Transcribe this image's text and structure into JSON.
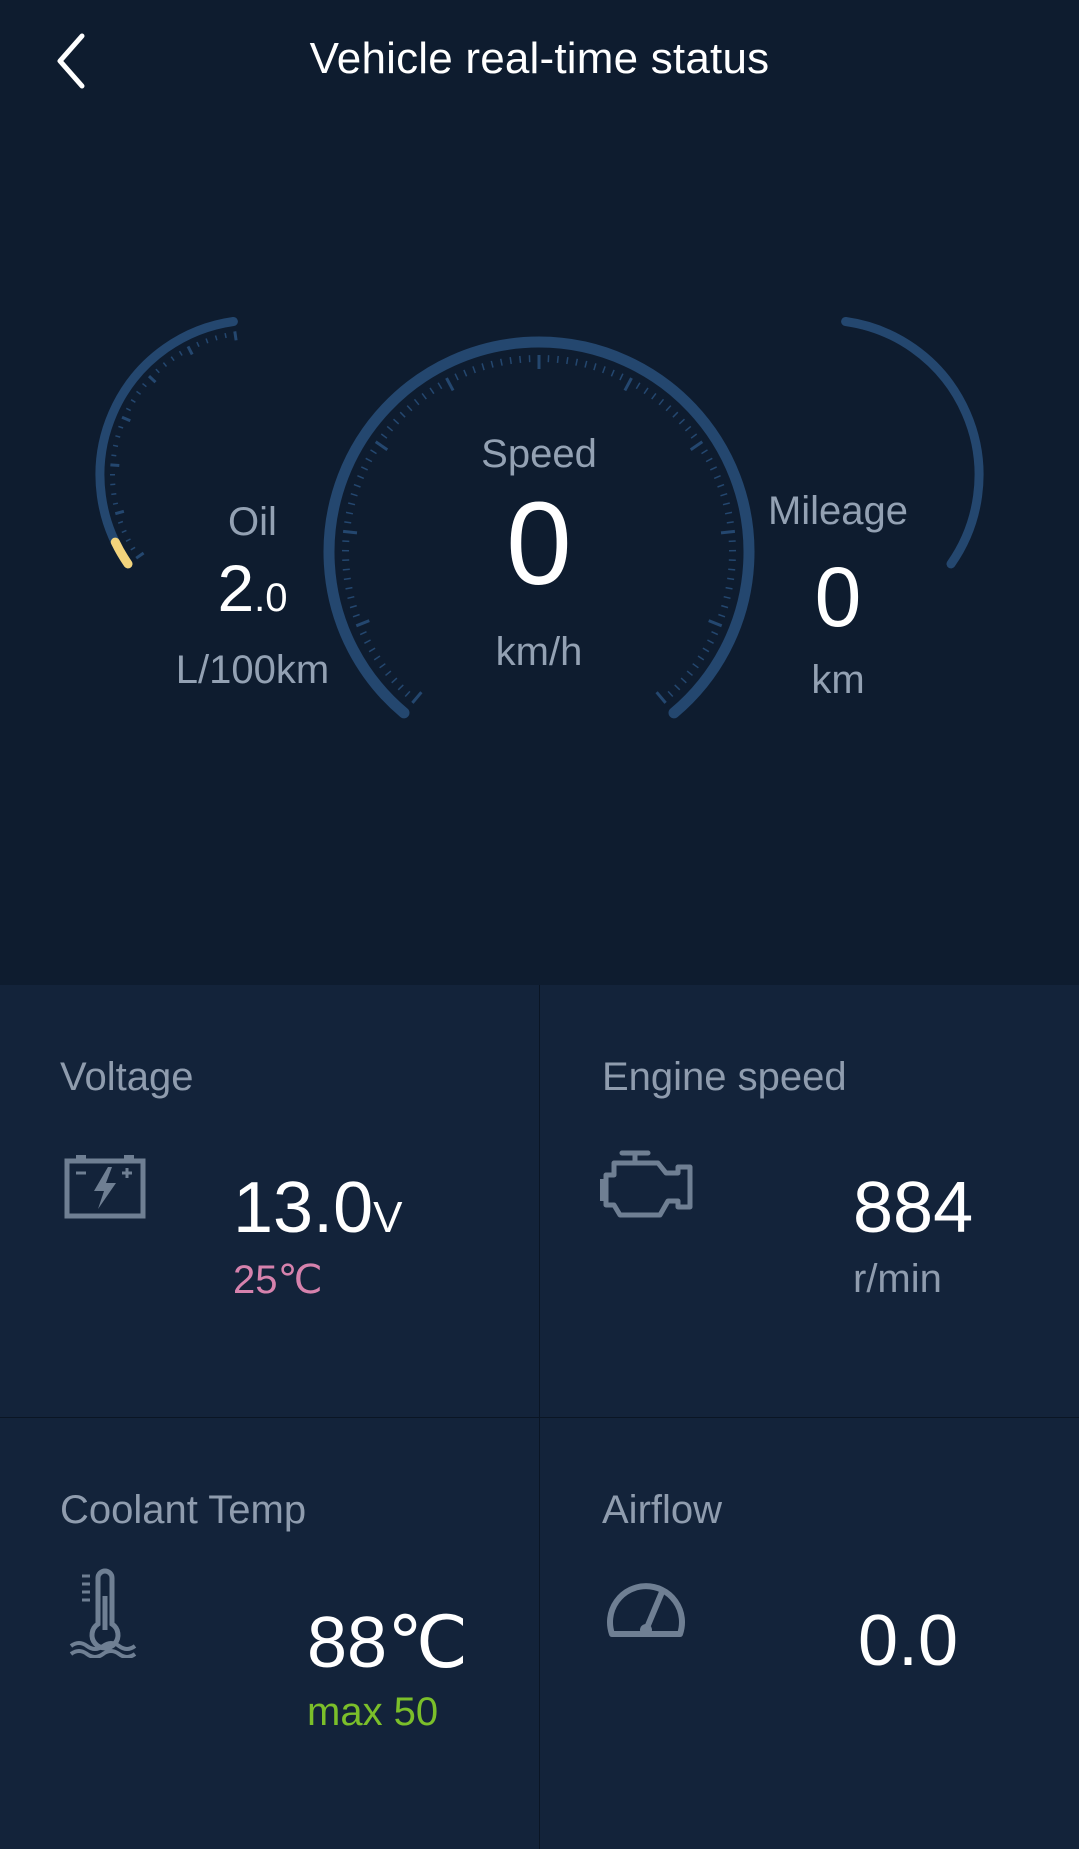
{
  "header": {
    "title": "Vehicle real-time status"
  },
  "gauges": {
    "oil": {
      "label": "Oil",
      "value_int": "2",
      "value_dec": ".0",
      "unit": "L/100km",
      "level_fraction": 0.08,
      "level_color": "#f2d37c"
    },
    "speed": {
      "label": "Speed",
      "value": "0",
      "unit": "km/h"
    },
    "mileage": {
      "label": "Mileage",
      "value": "0",
      "unit": "km"
    },
    "arc_color": "#24476f"
  },
  "cards": {
    "voltage": {
      "title": "Voltage",
      "icon": "battery-icon",
      "value": "13.0",
      "unit": "V",
      "sub": "25℃",
      "sub_color": "#d682ad"
    },
    "engine_speed": {
      "title": "Engine speed",
      "icon": "engine-icon",
      "value": "884",
      "sub": "r/min",
      "sub_color": "#8f9cae"
    },
    "coolant": {
      "title": "Coolant Temp",
      "icon": "thermometer-icon",
      "value": "88℃",
      "sub": "max 50",
      "sub_color": "#7bbf2a"
    },
    "airflow": {
      "title": "Airflow",
      "icon": "gauge-icon",
      "value": "0.0"
    }
  }
}
